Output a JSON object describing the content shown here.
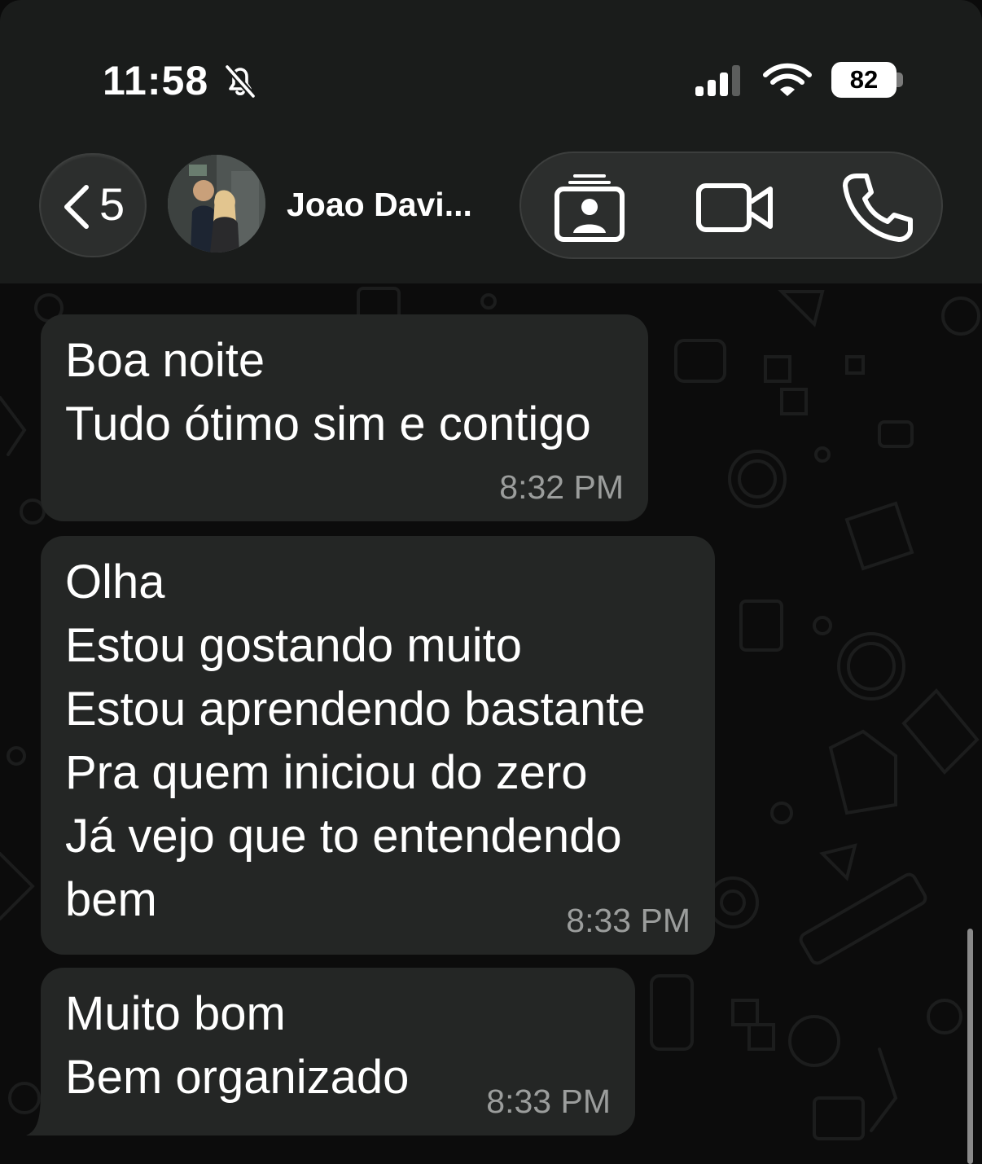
{
  "status_bar": {
    "time": "11:58",
    "battery": "82",
    "icons": [
      "bell-slash-icon",
      "signal-bars-icon",
      "wifi-icon",
      "battery-icon"
    ]
  },
  "header": {
    "back_count": "5",
    "contact_name": "Joao Davi...",
    "actions": [
      "contacts-stack-icon",
      "video-camera-icon",
      "phone-icon"
    ]
  },
  "messages": [
    {
      "lines": [
        "Boa noite",
        "Tudo ótimo sim e contigo"
      ],
      "time": "8:32 PM"
    },
    {
      "lines": [
        "Olha",
        "Estou gostando muito",
        "Estou aprendendo bastante",
        "Pra quem iniciou do zero",
        "Já vejo que to entendendo",
        "bem"
      ],
      "time": "8:33 PM"
    },
    {
      "lines": [
        "Muito bom",
        "Bem organizado"
      ],
      "time": "8:33 PM"
    }
  ],
  "colors": {
    "header_bg": "#1a1c1b",
    "bubble_bg": "#242625",
    "timestamp": "#9b9d9c",
    "chat_bg": "#0c0c0c"
  }
}
